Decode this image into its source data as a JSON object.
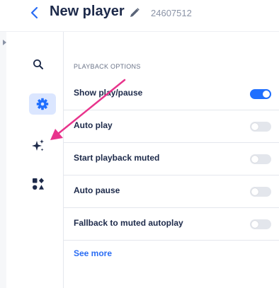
{
  "header": {
    "back_icon": "chevron-left-icon",
    "title": "New player",
    "edit_icon": "pencil-icon",
    "player_id": "24607512"
  },
  "sidebar": {
    "items": [
      {
        "icon": "search-icon",
        "active": false
      },
      {
        "icon": "gear-icon",
        "active": true
      },
      {
        "icon": "sparkles-icon",
        "active": false
      },
      {
        "icon": "shapes-icon",
        "active": false
      }
    ]
  },
  "main": {
    "section_label": "PLAYBACK OPTIONS",
    "options": [
      {
        "label": "Show play/pause",
        "enabled": true
      },
      {
        "label": "Auto play",
        "enabled": false
      },
      {
        "label": "Start playback muted",
        "enabled": false
      },
      {
        "label": "Auto pause",
        "enabled": false
      },
      {
        "label": "Fallback to muted autoplay",
        "enabled": false
      }
    ],
    "see_more": "See more"
  },
  "annotation": {
    "type": "arrow",
    "color": "#e8348c"
  },
  "colors": {
    "accent": "#1f6fff",
    "active_bg": "#dbe6ff",
    "text": "#1d2a4a",
    "muted": "#8a93a6"
  }
}
